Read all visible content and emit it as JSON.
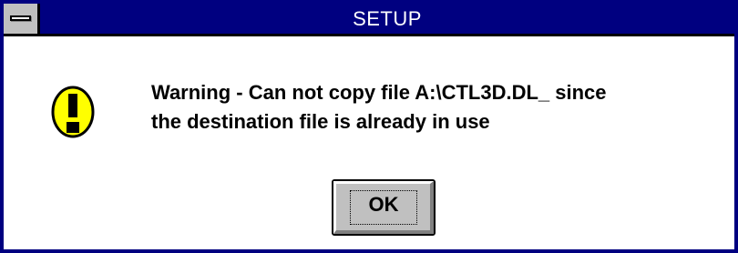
{
  "window": {
    "title": "SETUP"
  },
  "message": {
    "line1": "Warning - Can not copy file A:\\CTL3D.DL_  since",
    "line2": "the destination file is already in use"
  },
  "buttons": {
    "ok_label": "OK"
  },
  "icons": {
    "system_menu": "system-menu-icon",
    "alert": "exclamation-icon"
  },
  "colors": {
    "titlebar": "#000080",
    "border": "#000080",
    "button_face": "#c0c0c0",
    "icon_fill": "#ffff00"
  }
}
